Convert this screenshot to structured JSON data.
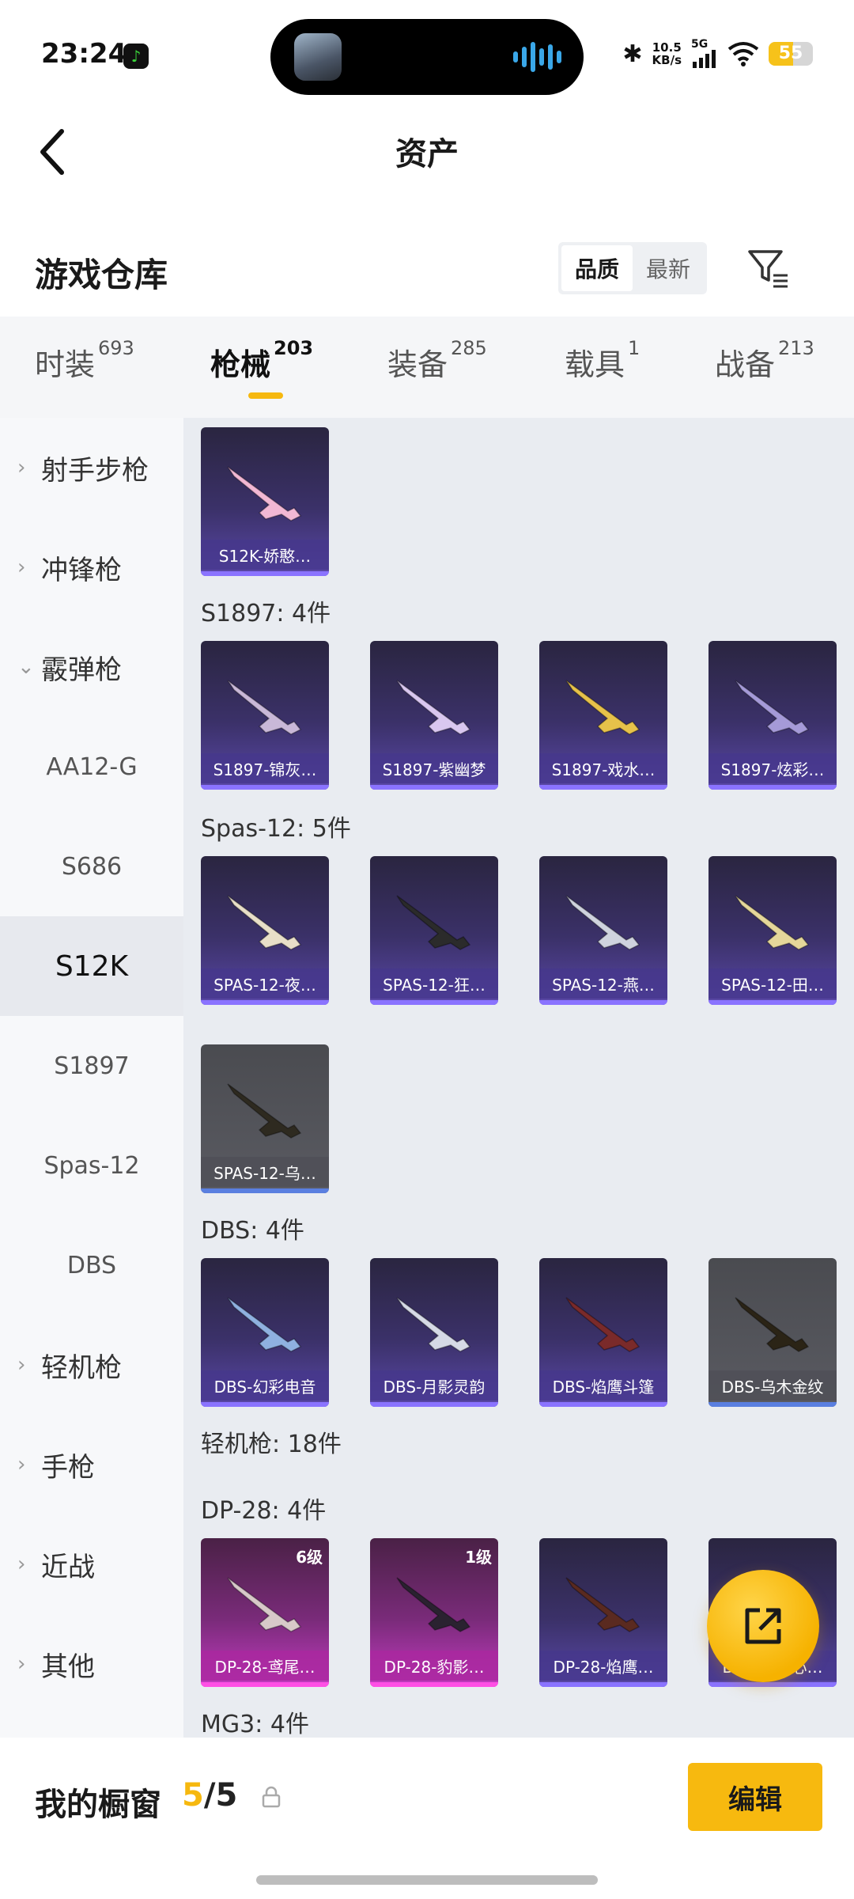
{
  "status_bar": {
    "time": "23:24",
    "net_speed_value": "10.5",
    "net_speed_unit": "KB/s",
    "network": "5G",
    "battery": "55",
    "colors": {
      "island": "#000000",
      "battery_fill": "#f6c21a"
    }
  },
  "header": {
    "title": "资产",
    "back_icon": "chevron-left-icon"
  },
  "warehouse": {
    "title": "游戏仓库",
    "sort_options": [
      "品质",
      "最新"
    ],
    "sort_selected": "品质",
    "filter_icon": "filter-icon"
  },
  "tabs": [
    {
      "label": "时装",
      "count": "693"
    },
    {
      "label": "枪械",
      "count": "203"
    },
    {
      "label": "装备",
      "count": "285"
    },
    {
      "label": "载具",
      "count": "1"
    },
    {
      "label": "战备",
      "count": "213"
    }
  ],
  "active_tab": "枪械",
  "sidebar": [
    {
      "label": "射手步枪",
      "type": "parent",
      "expanded": false
    },
    {
      "label": "冲锋枪",
      "type": "parent",
      "expanded": false
    },
    {
      "label": "霰弹枪",
      "type": "parent",
      "expanded": true
    },
    {
      "label": "AA12-G",
      "type": "child"
    },
    {
      "label": "S686",
      "type": "child"
    },
    {
      "label": "S12K",
      "type": "child",
      "selected": true
    },
    {
      "label": "S1897",
      "type": "child"
    },
    {
      "label": "Spas-12",
      "type": "child"
    },
    {
      "label": "DBS",
      "type": "child"
    },
    {
      "label": "轻机枪",
      "type": "parent",
      "expanded": false
    },
    {
      "label": "手枪",
      "type": "parent",
      "expanded": false
    },
    {
      "label": "近战",
      "type": "parent",
      "expanded": false
    },
    {
      "label": "其他",
      "type": "parent",
      "expanded": false
    }
  ],
  "content": {
    "groups": [
      {
        "label": "",
        "items": [
          {
            "name": "S12K-娇憨…",
            "rarity": "purple"
          }
        ]
      },
      {
        "label": "S1897: 4件",
        "items": [
          {
            "name": "S1897-锦灰…",
            "rarity": "purple"
          },
          {
            "name": "S1897-紫幽梦",
            "rarity": "purple"
          },
          {
            "name": "S1897-戏水…",
            "rarity": "purple"
          },
          {
            "name": "S1897-炫彩…",
            "rarity": "purple"
          }
        ]
      },
      {
        "label": "Spas-12: 5件",
        "items": [
          {
            "name": "SPAS-12-夜…",
            "rarity": "purple"
          },
          {
            "name": "SPAS-12-狂…",
            "rarity": "purple"
          },
          {
            "name": "SPAS-12-燕…",
            "rarity": "purple"
          },
          {
            "name": "SPAS-12-田…",
            "rarity": "purple"
          },
          {
            "name": "SPAS-12-乌…",
            "rarity": "grey"
          }
        ]
      },
      {
        "label": "DBS: 4件",
        "items": [
          {
            "name": "DBS-幻彩电音",
            "rarity": "purple"
          },
          {
            "name": "DBS-月影灵韵",
            "rarity": "purple"
          },
          {
            "name": "DBS-焰鹰斗篷",
            "rarity": "purple"
          },
          {
            "name": "DBS-乌木金纹",
            "rarity": "grey"
          }
        ]
      },
      {
        "label": "轻机枪: 18件",
        "items": []
      },
      {
        "label": "DP-28: 4件",
        "items": [
          {
            "name": "DP-28-鸢尾…",
            "rarity": "pink",
            "level": "6级"
          },
          {
            "name": "DP-28-豹影…",
            "rarity": "pink",
            "level": "1级"
          },
          {
            "name": "DP-28-焰鹰…",
            "rarity": "purple"
          },
          {
            "name": "DP-28-…心…",
            "rarity": "purple"
          }
        ]
      },
      {
        "label": "MG3: 4件",
        "items": []
      }
    ]
  },
  "fab": {
    "icon": "share-icon"
  },
  "bottom_bar": {
    "title": "我的橱窗",
    "count_current": "5",
    "count_total": "5",
    "separator": "/",
    "lock_icon": "lock-icon",
    "edit_label": "编辑"
  },
  "colors": {
    "accent": "#f6b80f",
    "rarity_purple": "#5a48a8",
    "rarity_grey": "#5a5b62",
    "rarity_pink": "#c23bc0"
  }
}
